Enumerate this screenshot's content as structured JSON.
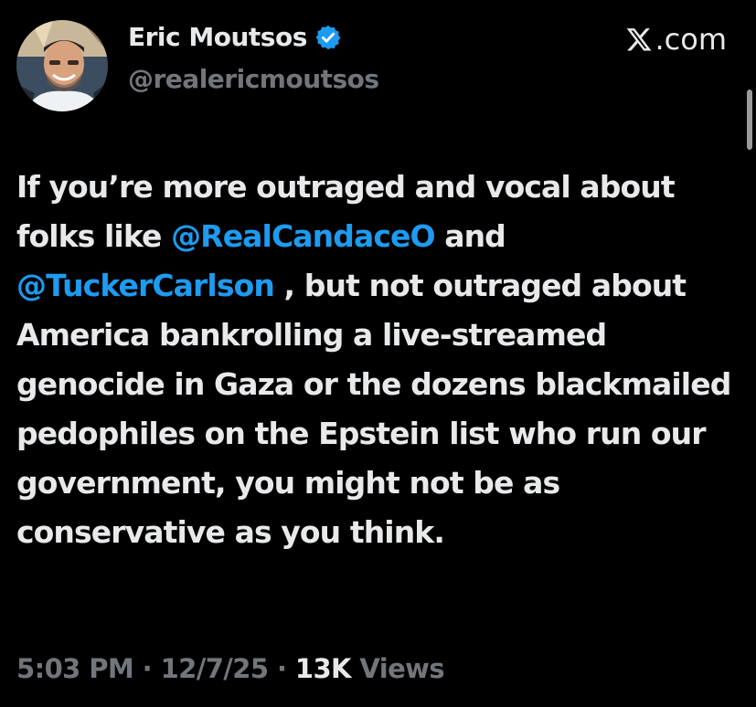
{
  "author": {
    "display_name": "Eric Moutsos",
    "handle": "@realericmoutsos",
    "verified": true,
    "verified_color": "#1d9bf0"
  },
  "site": {
    "label": ".com",
    "logo": "x-logo-icon"
  },
  "tweet": {
    "text_parts": [
      {
        "type": "text",
        "value": "If you’re more outraged and vocal about folks like "
      },
      {
        "type": "mention",
        "value": "@RealCandaceO"
      },
      {
        "type": "text",
        "value": " and "
      },
      {
        "type": "mention",
        "value": "@TuckerCarlson"
      },
      {
        "type": "text",
        "value": " , but not outraged about America bankrolling a live-streamed genocide in Gaza or the dozens blackmailed pedophiles on the Epstein list who run our government, you might not be as conservative as you think."
      }
    ]
  },
  "meta": {
    "time": "5:03 PM",
    "separator": " · ",
    "date": "12/7/25",
    "views_count": "13K",
    "views_label": " Views"
  },
  "colors": {
    "background": "#000000",
    "text": "#e7e9ea",
    "secondary": "#71767b",
    "link": "#1d9bf0"
  }
}
